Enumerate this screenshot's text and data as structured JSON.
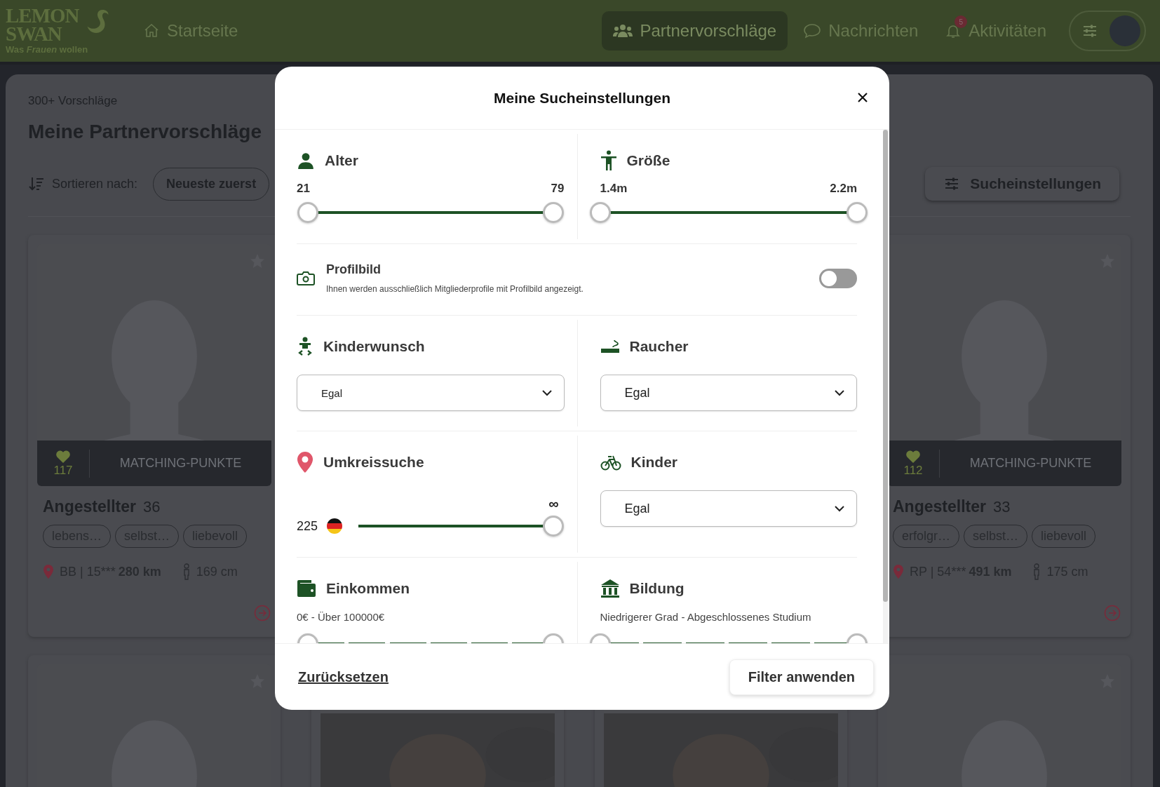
{
  "header": {
    "logo": {
      "line1": "LEMON",
      "line2": "SWAN",
      "tagline": "Was *Frauen* wollen"
    },
    "nav": [
      {
        "label": "Startseite",
        "selected": false
      },
      {
        "label": "Partnervorschläge",
        "selected": true
      },
      {
        "label": "Nachrichten",
        "selected": false
      },
      {
        "label": "Aktivitäten",
        "selected": false,
        "badge": "5"
      }
    ]
  },
  "page": {
    "count": "300+ Vorschläge",
    "title": "Meine Partnervorschläge",
    "sort_label": "Sortieren nach:",
    "sort_value": "Neueste zuerst",
    "settings_button": "Sucheinstellungen",
    "cards": [
      {
        "points": "117",
        "points_label": "MATCHING-PUNKTE",
        "title": "Angestellter",
        "age": "36",
        "tags": [
          "lebens…",
          "selbst…",
          "liebevoll"
        ],
        "location": "BB | 15***",
        "distance": "280 km",
        "height": "169 cm"
      },
      {
        "points": "112",
        "points_label": "MATCHING-PUNKTE",
        "title": "Angestellter",
        "age": "33",
        "tags": [
          "erfolgr…",
          "selbst…",
          "liebevoll"
        ],
        "location": "RP | 54***",
        "distance": "491 km",
        "height": "175 cm"
      }
    ],
    "next_row": [
      {
        "kind": "silhouette"
      },
      {
        "kind": "picture"
      },
      {
        "kind": "picture"
      },
      {
        "kind": "silhouette"
      }
    ]
  },
  "modal": {
    "title": "Meine Sucheinstellungen",
    "rows": [
      {
        "kind": "pair",
        "items": [
          {
            "kind": "range",
            "label": "Alter",
            "low_label": "21",
            "high_label": "79",
            "handles": [
              {
                "level": 0
              },
              {
                "level": 1
              }
            ]
          },
          {
            "kind": "range",
            "label": "Größe",
            "low_label": "1.4m",
            "high_label": "2.2m",
            "handles": [
              {
                "level": 0
              },
              {
                "level": 1
              }
            ]
          }
        ]
      },
      {
        "kind": "toggle",
        "label": "Profilbild",
        "description": "Ihnen werden ausschließlich Mitgliederprofile mit Profilbild angezeigt.",
        "on": false
      },
      {
        "kind": "pair",
        "items": [
          {
            "kind": "select",
            "label": "Kinderwunsch",
            "value": "Egal"
          },
          {
            "kind": "select",
            "label": "Raucher",
            "value": "Egal"
          }
        ]
      },
      {
        "kind": "pair",
        "items": [
          {
            "kind": "distance",
            "label": "Umkreissuche",
            "value": "225",
            "max_label": "∞",
            "level": 1
          },
          {
            "kind": "select",
            "label": "Kinder",
            "value": "Egal"
          }
        ]
      },
      {
        "kind": "pair",
        "items": [
          {
            "kind": "steps",
            "label": "Einkommen",
            "range_text": "0€ - Über 100000€",
            "handles": [
              {
                "level": 0
              },
              {
                "level": 1
              }
            ]
          },
          {
            "kind": "steps",
            "label": "Bildung",
            "range_text": "Niedrigerer Grad - Abgeschlossenes Studium",
            "handles": [
              {
                "level": 0
              },
              {
                "level": 1
              }
            ]
          }
        ]
      }
    ],
    "reset": "Zurücksetzen",
    "apply": "Filter anwenden"
  }
}
